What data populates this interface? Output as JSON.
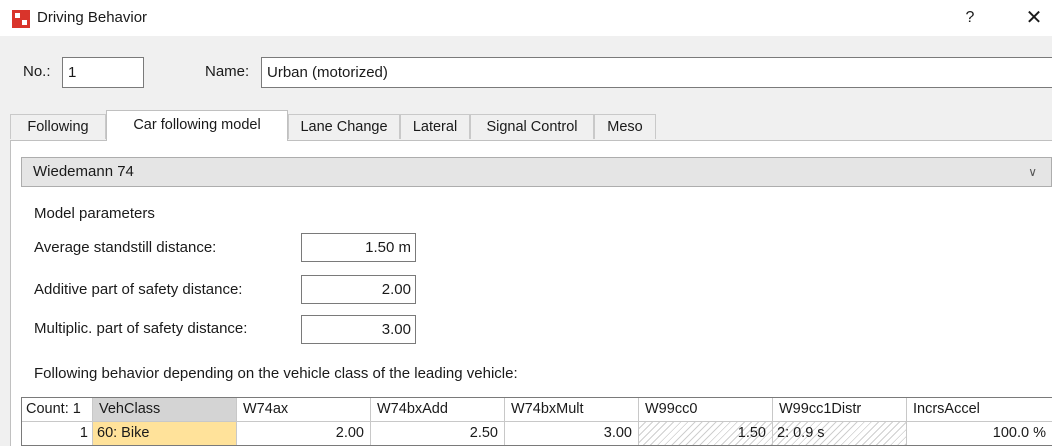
{
  "window": {
    "title": "Driving Behavior",
    "help_label": "?",
    "close_label": "✕"
  },
  "form": {
    "no_label": "No.:",
    "no_value": "1",
    "name_label": "Name:",
    "name_value": "Urban (motorized)"
  },
  "tabs": [
    {
      "label": "Following"
    },
    {
      "label": "Car following model",
      "active": true
    },
    {
      "label": "Lane Change"
    },
    {
      "label": "Lateral"
    },
    {
      "label": "Signal Control"
    },
    {
      "label": "Meso"
    }
  ],
  "model_select": {
    "value": "Wiedemann 74",
    "chevron": "∨"
  },
  "params": {
    "section_label": "Model parameters",
    "avg_standstill_label": "Average standstill distance:",
    "avg_standstill_value": "1.50 m",
    "additive_label": "Additive part of safety distance:",
    "additive_value": "2.00",
    "multiplic_label": "Multiplic. part of safety distance:",
    "multiplic_value": "3.00"
  },
  "following_behavior_label": "Following behavior depending on the vehicle class of the leading vehicle:",
  "grid": {
    "count_header": "Count: 1",
    "headers": [
      "VehClass",
      "W74ax",
      "W74bxAdd",
      "W74bxMult",
      "W99cc0",
      "W99cc1Distr",
      "IncrsAccel"
    ],
    "rows": [
      {
        "index": "1",
        "vehclass": "60: Bike",
        "w74ax": "2.00",
        "w74bxadd": "2.50",
        "w74bxmult": "3.00",
        "w99cc0": "1.50",
        "w99cc1distr": "2: 0.9 s",
        "incrsaccel": "100.0 %"
      }
    ]
  },
  "colors": {
    "selected_cell": "#ffe29a",
    "app_icon": "#d9342b"
  }
}
